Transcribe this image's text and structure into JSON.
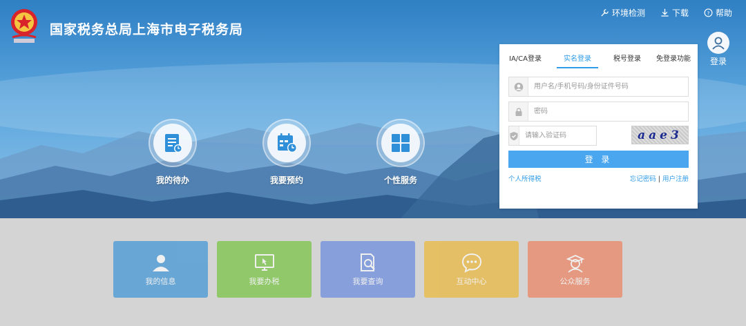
{
  "header": {
    "site_title": "国家税务总局上海市电子税务局",
    "links": [
      {
        "label": "环境检测",
        "icon": "wrench-icon"
      },
      {
        "label": "下载",
        "icon": "download-icon"
      },
      {
        "label": "帮助",
        "icon": "help-icon"
      }
    ],
    "user_login_label": "登录"
  },
  "services": [
    {
      "label": "我的待办",
      "icon": "todo-icon"
    },
    {
      "label": "我要预约",
      "icon": "calendar-icon"
    },
    {
      "label": "个性服务",
      "icon": "grid-icon"
    }
  ],
  "tiles": [
    {
      "label": "我的信息",
      "icon": "person-icon",
      "color": "#2f8fd8"
    },
    {
      "label": "我要办税",
      "icon": "monitor-icon",
      "color": "#6cc233"
    },
    {
      "label": "我要查询",
      "icon": "search-doc-icon",
      "color": "#5e84e0"
    },
    {
      "label": "互动中心",
      "icon": "chat-icon",
      "color": "#efb52a"
    },
    {
      "label": "公众服务",
      "icon": "service-icon",
      "color": "#ef7a55"
    }
  ],
  "login": {
    "tabs": [
      "IA/CA登录",
      "实名登录",
      "税号登录",
      "免登录功能"
    ],
    "active_tab": 1,
    "username_placeholder": "用户名/手机号码/身份证件号码",
    "password_placeholder": "密码",
    "captcha_placeholder": "请输入验证码",
    "captcha_text": "aae3",
    "button_label": "登 录",
    "personal_tax_link": "个人所得税",
    "forgot_password_link": "忘记密码",
    "register_link": "用户注册",
    "separator": "|"
  },
  "colors": {
    "accent": "#2f9be8",
    "button": "#4aa6ef"
  }
}
